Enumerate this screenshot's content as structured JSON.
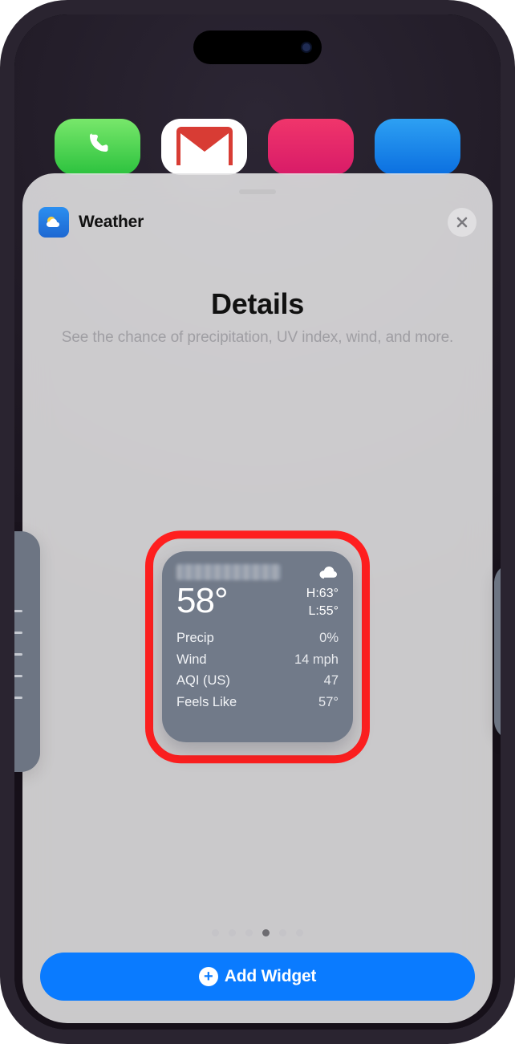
{
  "app": {
    "name": "Weather"
  },
  "section": {
    "title": "Details",
    "subtitle": "See the chance of precipitation, UV index, wind, and more."
  },
  "widget": {
    "location_redacted": true,
    "current_temp": "58°",
    "high": "H:63°",
    "low": "L:55°",
    "rows": [
      {
        "label": "Precip",
        "value": "0%"
      },
      {
        "label": "Wind",
        "value": "14 mph"
      },
      {
        "label": "AQI (US)",
        "value": "47"
      },
      {
        "label": "Feels Like",
        "value": "57°"
      }
    ]
  },
  "pager": {
    "count": 6,
    "active_index": 3
  },
  "cta": {
    "label": "Add Widget"
  },
  "colors": {
    "primary": "#0a7bff",
    "highlight_ring": "#ff1f1f"
  }
}
